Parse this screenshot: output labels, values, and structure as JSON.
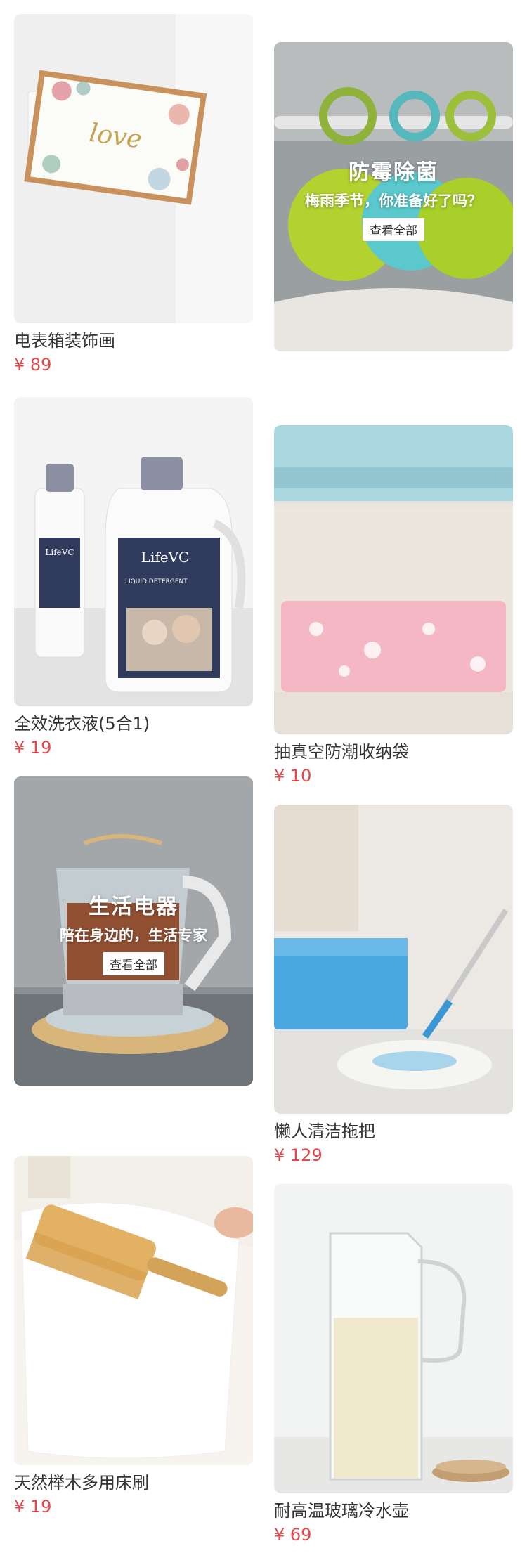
{
  "products": [
    {
      "name": "电表箱装饰画",
      "price": "¥ 89"
    },
    {
      "name": "全效洗衣液(5合1)",
      "price": "¥ 19"
    },
    {
      "name": "天然榉木多用床刷",
      "price": "¥ 19"
    },
    {
      "name": "抽真空防潮收纳袋",
      "price": "¥ 10"
    },
    {
      "name": "懒人清洁拖把",
      "price": "¥ 129"
    },
    {
      "name": "耐高温玻璃冷水壶",
      "price": "¥ 69"
    }
  ],
  "promos": [
    {
      "title": "防霉除菌",
      "subtitle": "梅雨季节，你准备好了吗？",
      "button": "查看全部"
    },
    {
      "title": "生活电器",
      "subtitle": "陪在身边的，生活专家",
      "button": "查看全部"
    }
  ],
  "images": {
    "art_text": "love",
    "brand": "LifeVC",
    "detergent_label": "LIQUID DETERGENT"
  },
  "colors": {
    "price": "#e5474a",
    "text": "#333333"
  }
}
